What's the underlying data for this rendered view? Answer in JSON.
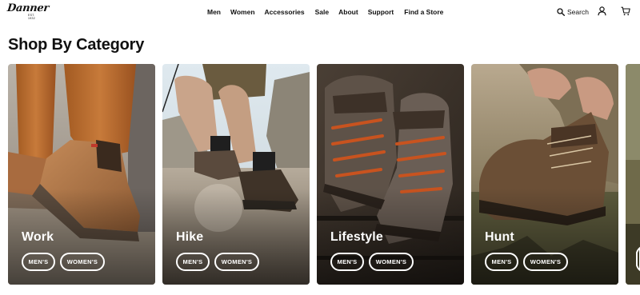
{
  "header": {
    "logo": {
      "text": "Danner",
      "sub": "EST. 1932"
    },
    "nav": [
      "Men",
      "Women",
      "Accessories",
      "Sale",
      "About",
      "Support",
      "Find a Store"
    ],
    "search_label": "Search",
    "icons": {
      "search": "search-icon",
      "account": "user-icon",
      "cart": "cart-icon"
    }
  },
  "main": {
    "title": "Shop By Category",
    "categories": [
      {
        "title": "Work",
        "mens": "MEN'S",
        "womens": "WOMEN'S"
      },
      {
        "title": "Hike",
        "mens": "MEN'S",
        "womens": "WOMEN'S"
      },
      {
        "title": "Lifestyle",
        "mens": "MEN'S",
        "womens": "WOMEN'S"
      },
      {
        "title": "Hunt",
        "mens": "MEN'S",
        "womens": "WOMEN'S"
      }
    ]
  },
  "colors": {
    "text": "#111111",
    "background": "#ffffff",
    "card_text": "#ffffff"
  }
}
